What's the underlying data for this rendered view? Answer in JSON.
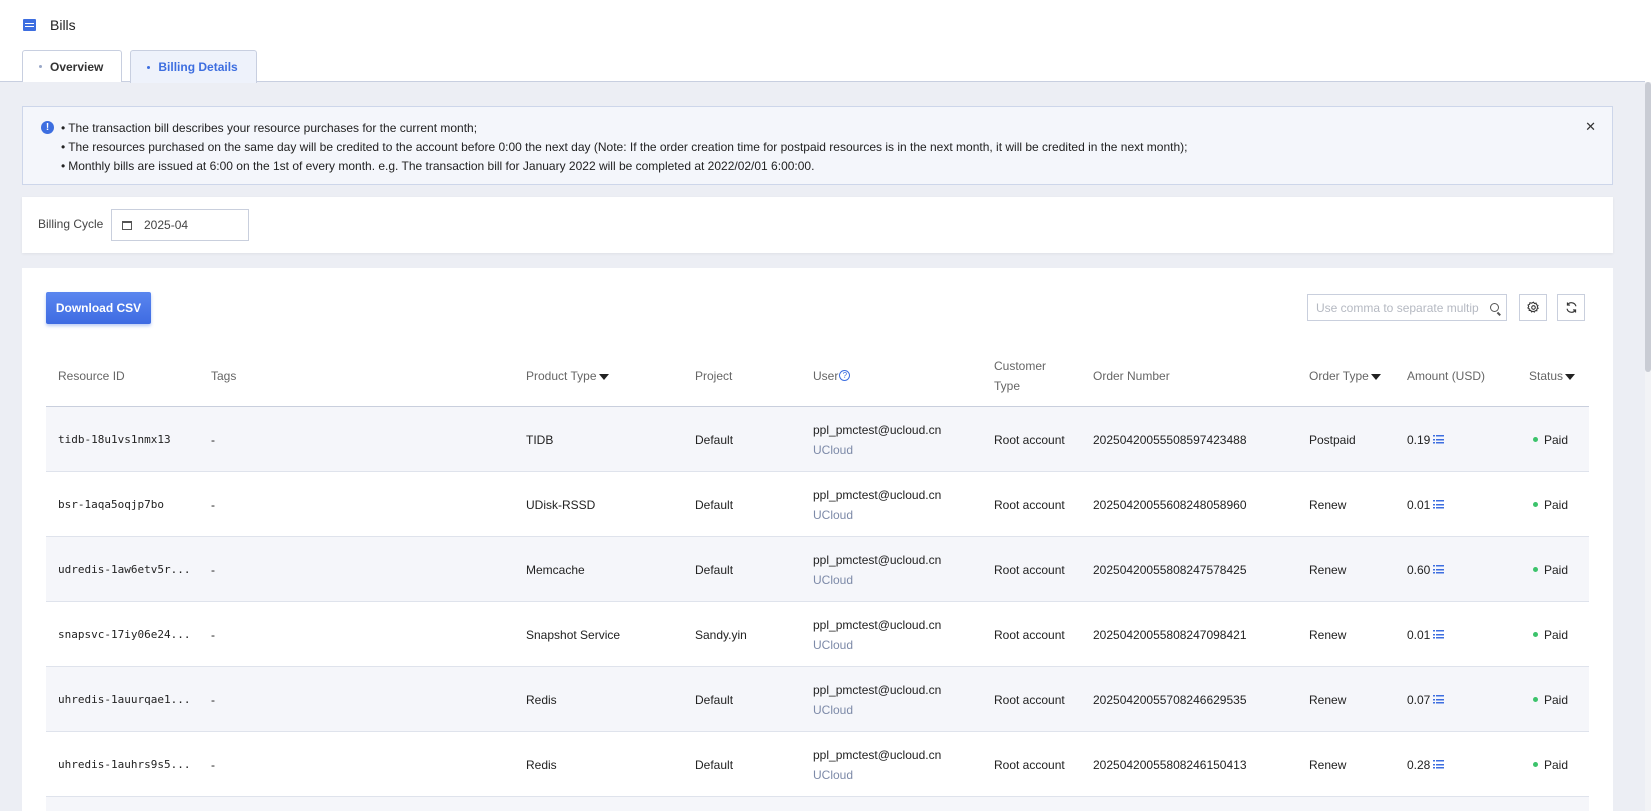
{
  "header": {
    "title": "Bills",
    "tabs": [
      {
        "label": "Overview",
        "active": false
      },
      {
        "label": "Billing Details",
        "active": true
      }
    ]
  },
  "notice": {
    "lines": [
      "The transaction bill describes your resource purchases for the current month;",
      "The resources purchased on the same day will be credited to the account before 0:00 the next day (Note: If the order creation time for postpaid resources is in the next month, it will be credited in the next month);",
      "Monthly bills are issued at 6:00 on the 1st of every month. e.g. The transaction bill for January 2022 will be completed at 2022/02/01 6:00:00."
    ],
    "close_label": "✕"
  },
  "filter": {
    "billing_cycle_label": "Billing Cycle",
    "billing_cycle_value": "2025-04"
  },
  "toolbar": {
    "download_label": "Download CSV",
    "search_placeholder": "Use comma to separate multip",
    "settings_icon": "gear-icon",
    "refresh_icon": "refresh-icon"
  },
  "table": {
    "columns": {
      "resource_id": "Resource ID",
      "tags": "Tags",
      "product_type": "Product Type",
      "project": "Project",
      "user": "User",
      "customer_type": "Customer Type",
      "order_number": "Order Number",
      "order_type": "Order Type",
      "amount": "Amount (USD)",
      "status": "Status"
    },
    "rows": [
      {
        "resource_id": "tidb-18u1vs1nmx13",
        "tags": "-",
        "product_type": "TIDB",
        "project": "Default",
        "user": "ppl_pmctest@ucloud.cn",
        "user_org": "UCloud",
        "customer_type": "Root account",
        "order_number": "20250420055508597423488",
        "order_type": "Postpaid",
        "amount": "0.19",
        "status": "Paid"
      },
      {
        "resource_id": "bsr-1aqa5oqjp7bo",
        "tags": "-",
        "product_type": "UDisk-RSSD",
        "project": "Default",
        "user": "ppl_pmctest@ucloud.cn",
        "user_org": "UCloud",
        "customer_type": "Root account",
        "order_number": "20250420055608248058960",
        "order_type": "Renew",
        "amount": "0.01",
        "status": "Paid"
      },
      {
        "resource_id": "udredis-1aw6etv5r...",
        "tags": "-",
        "product_type": "Memcache",
        "project": "Default",
        "user": "ppl_pmctest@ucloud.cn",
        "user_org": "UCloud",
        "customer_type": "Root account",
        "order_number": "20250420055808247578425",
        "order_type": "Renew",
        "amount": "0.60",
        "status": "Paid"
      },
      {
        "resource_id": "snapsvc-17iy06e24...",
        "tags": "-",
        "product_type": "Snapshot Service",
        "project": "Sandy.yin",
        "user": "ppl_pmctest@ucloud.cn",
        "user_org": "UCloud",
        "customer_type": "Root account",
        "order_number": "20250420055808247098421",
        "order_type": "Renew",
        "amount": "0.01",
        "status": "Paid"
      },
      {
        "resource_id": "uhredis-1auurqae1...",
        "tags": "-",
        "product_type": "Redis",
        "project": "Default",
        "user": "ppl_pmctest@ucloud.cn",
        "user_org": "UCloud",
        "customer_type": "Root account",
        "order_number": "20250420055708246629535",
        "order_type": "Renew",
        "amount": "0.07",
        "status": "Paid"
      },
      {
        "resource_id": "uhredis-1auhrs9s5...",
        "tags": "-",
        "product_type": "Redis",
        "project": "Default",
        "user": "ppl_pmctest@ucloud.cn",
        "user_org": "UCloud",
        "customer_type": "Root account",
        "order_number": "20250420055808246150413",
        "order_type": "Renew",
        "amount": "0.28",
        "status": "Paid"
      }
    ]
  },
  "colors": {
    "accent": "#3d6ee0",
    "status_paid": "#3cc36b",
    "background": "#eceef4"
  }
}
